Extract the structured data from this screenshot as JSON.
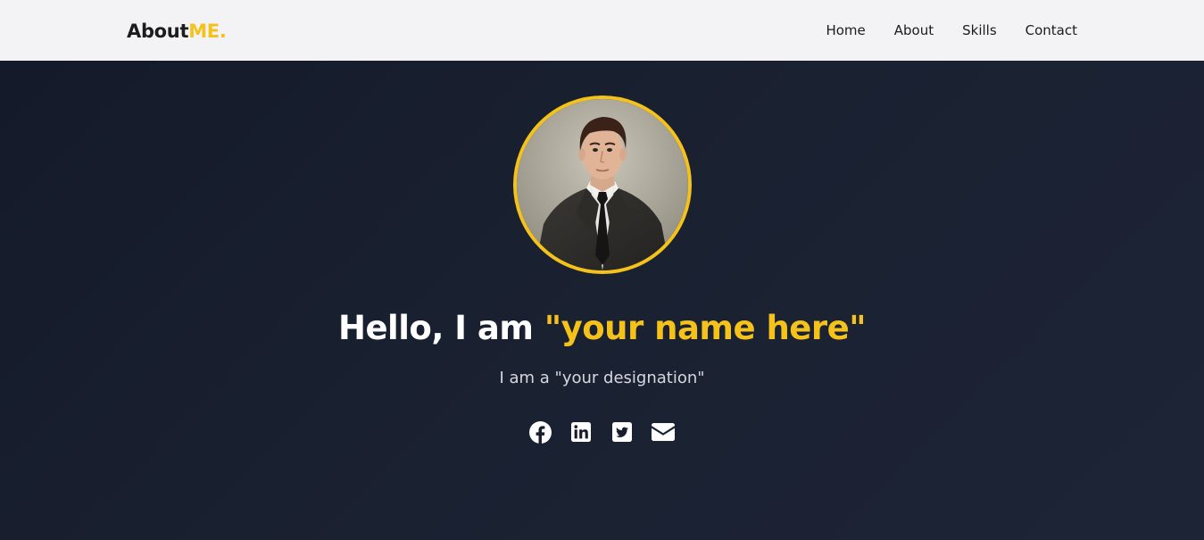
{
  "navbar": {
    "brand_main": "About",
    "brand_accent": "ME.",
    "links": [
      {
        "label": "Home"
      },
      {
        "label": "About"
      },
      {
        "label": "Skills"
      },
      {
        "label": "Contact"
      }
    ]
  },
  "hero": {
    "greeting": "Hello, I am",
    "name": "\"your name here\"",
    "designation": "I am a \"your designation\"",
    "socials": [
      {
        "icon": "facebook-icon"
      },
      {
        "icon": "linkedin-icon"
      },
      {
        "icon": "twitter-icon"
      },
      {
        "icon": "email-icon"
      }
    ]
  },
  "colors": {
    "accent": "#f4c21b",
    "nav_bg": "#f3f3f5",
    "hero_bg": "#171d2d",
    "text_light": "#ffffff"
  }
}
